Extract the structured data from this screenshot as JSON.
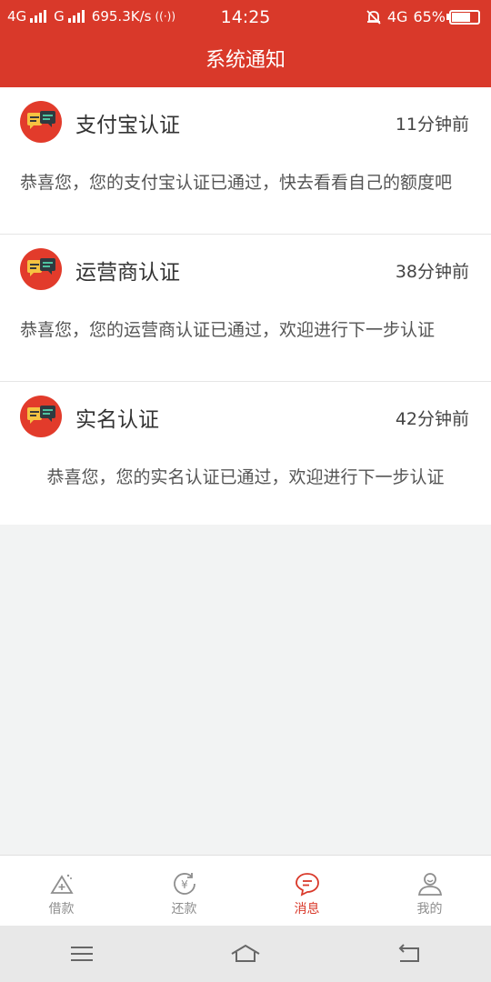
{
  "status_bar": {
    "network_left_1": "4G",
    "network_left_2": "G",
    "speed": "695.3K/s",
    "time": "14:25",
    "network_right": "4G",
    "battery": "65%"
  },
  "header": {
    "title": "系统通知"
  },
  "notifications": [
    {
      "title": "支付宝认证",
      "time": "11分钟前",
      "body": "恭喜您，您的支付宝认证已通过，快去看看自己的额度吧",
      "icon": "chat-bubbles-icon"
    },
    {
      "title": "运营商认证",
      "time": "38分钟前",
      "body": "恭喜您，您的运营商认证已通过，欢迎进行下一步认证",
      "icon": "chat-bubbles-icon"
    },
    {
      "title": "实名认证",
      "time": "42分钟前",
      "body": "恭喜您，您的实名认证已通过，欢迎进行下一步认证",
      "icon": "chat-bubbles-icon"
    }
  ],
  "tabbar": {
    "tabs": [
      {
        "label": "借款",
        "icon": "borrow-icon",
        "active": false
      },
      {
        "label": "还款",
        "icon": "repay-icon",
        "active": false
      },
      {
        "label": "消息",
        "icon": "message-icon",
        "active": true
      },
      {
        "label": "我的",
        "icon": "profile-icon",
        "active": false
      }
    ]
  },
  "colors": {
    "brand": "#d9392a",
    "background": "#f2f3f3",
    "tab_inactive": "#8e8e8e"
  }
}
